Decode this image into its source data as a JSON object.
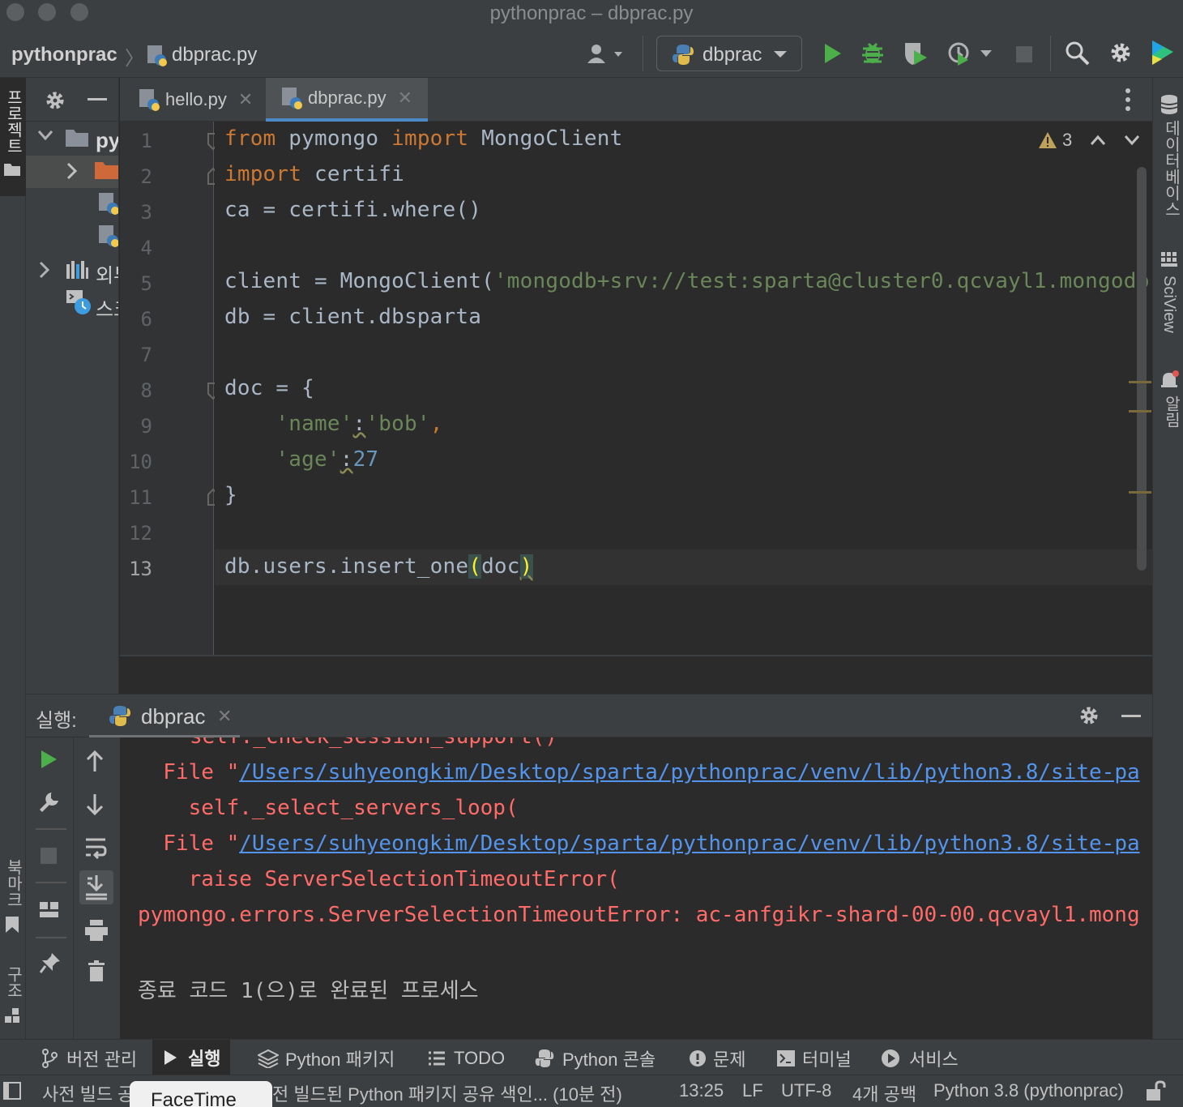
{
  "window": {
    "title": "pythonprac – dbprac.py"
  },
  "navbar": {
    "project": "pythonprac",
    "file": "dbprac.py",
    "run_config": "dbprac"
  },
  "left_stripe": {
    "project_label": "프로젝트",
    "bookmarks_label": "북마크",
    "structure_label": "구조"
  },
  "right_stripe": {
    "database_label": "데이터베이스",
    "sciview_label": "SciView",
    "notifications_label": "알림"
  },
  "project_tree": {
    "root": "py",
    "external": "외부",
    "scratches": "스크"
  },
  "tabs": [
    {
      "label": "hello.py",
      "active": false
    },
    {
      "label": "dbprac.py",
      "active": true
    }
  ],
  "editor": {
    "warnings_count": "3",
    "line_numbers": [
      "1",
      "2",
      "3",
      "4",
      "5",
      "6",
      "7",
      "8",
      "9",
      "10",
      "11",
      "12",
      "13"
    ],
    "current_line": "13",
    "lines": {
      "l1_from": "from",
      "l1_mod": " pymongo ",
      "l1_import": "import",
      "l1_name": " MongoClient",
      "l2_import": "import",
      "l2_mod": " certifi",
      "l3": "ca = certifi.where()",
      "l5_pre": "client = MongoClient(",
      "l5_str": "'mongodb+srv://test:sparta@cluster0.qcvayl1.mongodb",
      "l6": "db = client.dbsparta",
      "l8": "doc = {",
      "l9_indent": "    ",
      "l9_key": "'name'",
      "l9_colon": ":",
      "l9_val": "'bob'",
      "l9_comma": ",",
      "l10_indent": "    ",
      "l10_key": "'age'",
      "l10_colon": ":",
      "l10_val": "27",
      "l11": "}",
      "l13_pre": "db.users.insert_one",
      "l13_open": "(",
      "l13_arg": "doc",
      "l13_close": ")"
    }
  },
  "run_panel": {
    "label": "실행:",
    "tab": "dbprac",
    "console": {
      "cut_line": "self._check_session_support()",
      "file_prefix": "  File \"",
      "path1": "/Users/suhyeongkim/Desktop/sparta/pythonprac/venv/lib/python3.8/site-pa",
      "line_select": "    self._select_servers_loop(",
      "path2": "/Users/suhyeongkim/Desktop/sparta/pythonprac/venv/lib/python3.8/site-pa",
      "line_raise": "    raise ServerSelectionTimeoutError(",
      "error": "pymongo.errors.ServerSelectionTimeoutError: ac-anfgikr-shard-00-00.qcvayl1.mong",
      "exit": "종료 코드 1(으)로 완료된 프로세스"
    }
  },
  "bottom_tabs": [
    "버전 관리",
    "실행",
    "Python 패키지",
    "TODO",
    "Python 콘솔",
    "문제",
    "터미널",
    "서비스"
  ],
  "status_bar": {
    "left_msg_start": "사전 빌드 공",
    "left_msg_end": "전 빌드된 Python 패키지 공유 색인... (10분 전)",
    "position": "13:25",
    "line_sep": "LF",
    "encoding": "UTF-8",
    "indent": "4개 공백",
    "interpreter": "Python 3.8 (pythonprac)"
  },
  "overlay": {
    "facetime": "FaceTime"
  }
}
